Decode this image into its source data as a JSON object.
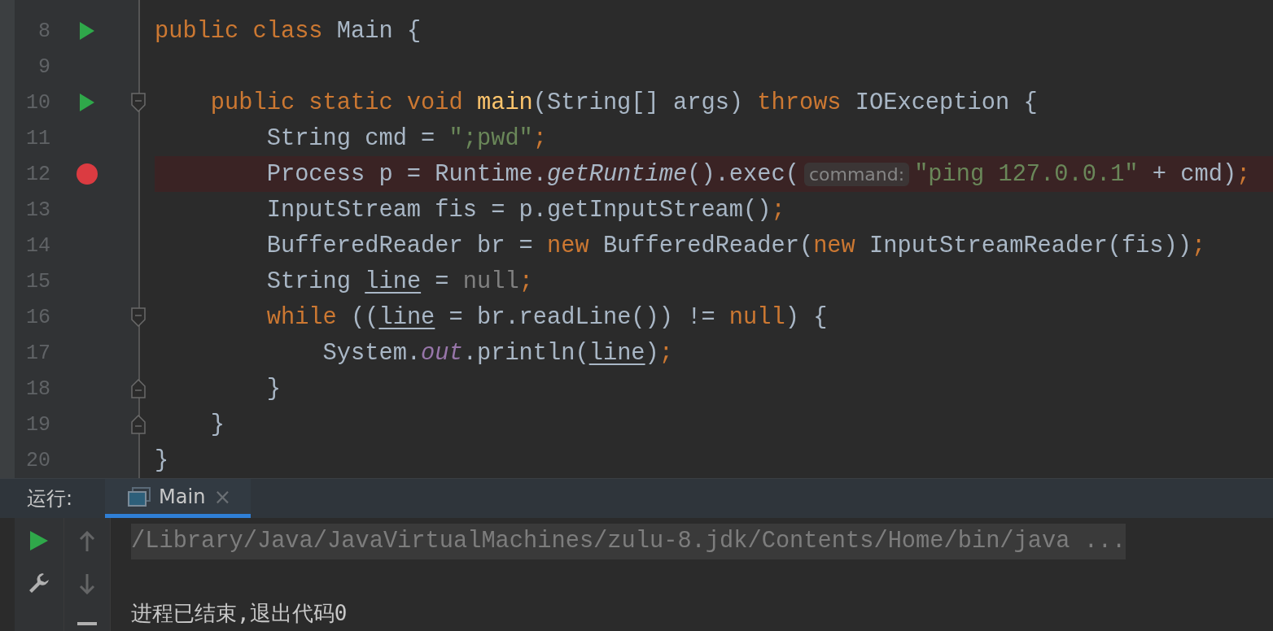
{
  "editor": {
    "lines": [
      {
        "number": "8",
        "runnable": true,
        "breakpoint": false,
        "fold_start": false,
        "fold_end": false,
        "highlighted": false,
        "tokens": [
          {
            "kind": "keyword",
            "text": "public class"
          },
          {
            "kind": "plain",
            "text": " Main {"
          }
        ],
        "children": [
          {
            "number": "9",
            "runnable": false,
            "breakpoint": false,
            "fold_start": false,
            "fold_end": false,
            "highlighted": false
          },
          {
            "number": "10",
            "runnable": true,
            "breakpoint": false,
            "fold_start": true,
            "fold_end": false,
            "highlighted": false,
            "tokens": [
              {
                "kind": "keyword",
                "text": "public static void "
              },
              {
                "kind": "method",
                "text": "main"
              },
              {
                "kind": "plain",
                "text": "(String[] args) "
              },
              {
                "kind": "keyword",
                "text": "throws"
              },
              {
                "kind": "plain",
                "text": " IOException {"
              }
            ],
            "children": [
              {
                "number": "11",
                "runnable": false,
                "breakpoint": false,
                "fold_start": false,
                "fold_end": false,
                "highlighted": false,
                "tokens": [
                  {
                    "kind": "plain",
                    "text": "String cmd = "
                  },
                  {
                    "kind": "string",
                    "text": "\";pwd\""
                  },
                  {
                    "kind": "punct",
                    "text": ";"
                  }
                ]
              },
              {
                "number": "12",
                "runnable": false,
                "breakpoint": true,
                "fold_start": false,
                "fold_end": false,
                "highlighted": true,
                "tokens": [
                  {
                    "kind": "plain",
                    "text": "Process p = Runtime."
                  },
                  {
                    "kind": "static",
                    "text": "getRuntime"
                  },
                  {
                    "kind": "plain",
                    "text": "().exec("
                  },
                  {
                    "kind": "hint",
                    "text": "command:"
                  },
                  {
                    "kind": "string",
                    "text": "\"ping 127.0.0.1\""
                  },
                  {
                    "kind": "plain",
                    "text": " + cmd)"
                  },
                  {
                    "kind": "punct",
                    "text": ";"
                  }
                ]
              },
              {
                "number": "13",
                "runnable": false,
                "breakpoint": false,
                "fold_start": false,
                "fold_end": false,
                "highlighted": false,
                "tokens": [
                  {
                    "kind": "plain",
                    "text": "InputStream fis = p.getInputStream()"
                  },
                  {
                    "kind": "punct",
                    "text": ";"
                  }
                ]
              },
              {
                "number": "14",
                "runnable": false,
                "breakpoint": false,
                "fold_start": false,
                "fold_end": false,
                "highlighted": false,
                "tokens": [
                  {
                    "kind": "plain",
                    "text": "BufferedReader br = "
                  },
                  {
                    "kind": "keyword",
                    "text": "new"
                  },
                  {
                    "kind": "plain",
                    "text": " BufferedReader("
                  },
                  {
                    "kind": "keyword",
                    "text": "new"
                  },
                  {
                    "kind": "plain",
                    "text": " InputStreamReader(fis))"
                  },
                  {
                    "kind": "punct",
                    "text": ";"
                  }
                ]
              },
              {
                "number": "15",
                "runnable": false,
                "breakpoint": false,
                "fold_start": false,
                "fold_end": false,
                "highlighted": false,
                "tokens": [
                  {
                    "kind": "plain",
                    "text": "String "
                  },
                  {
                    "kind": "var",
                    "text": "line"
                  },
                  {
                    "kind": "plain",
                    "text": " = "
                  },
                  {
                    "kind": "unused",
                    "text": "null"
                  },
                  {
                    "kind": "punct",
                    "text": ";"
                  }
                ]
              },
              {
                "number": "16",
                "runnable": false,
                "breakpoint": false,
                "fold_start": true,
                "fold_end": false,
                "highlighted": false,
                "tokens": [
                  {
                    "kind": "keyword",
                    "text": "while"
                  },
                  {
                    "kind": "plain",
                    "text": " (("
                  },
                  {
                    "kind": "var",
                    "text": "line"
                  },
                  {
                    "kind": "plain",
                    "text": " = br.readLine()) != "
                  },
                  {
                    "kind": "keyword",
                    "text": "null"
                  },
                  {
                    "kind": "plain",
                    "text": ") {"
                  }
                ],
                "children": [
                  {
                    "number": "17",
                    "runnable": false,
                    "breakpoint": false,
                    "fold_start": false,
                    "fold_end": false,
                    "highlighted": false,
                    "tokens": [
                      {
                        "kind": "plain",
                        "text": "System."
                      },
                      {
                        "kind": "field",
                        "text": "out"
                      },
                      {
                        "kind": "plain",
                        "text": ".println("
                      },
                      {
                        "kind": "var",
                        "text": "line"
                      },
                      {
                        "kind": "plain",
                        "text": ")"
                      },
                      {
                        "kind": "punct",
                        "text": ";"
                      }
                    ]
                  }
                ]
              },
              {
                "number": "18",
                "runnable": false,
                "breakpoint": false,
                "fold_start": false,
                "fold_end": true,
                "highlighted": false,
                "tokens": [
                  {
                    "kind": "plain",
                    "text": "}"
                  }
                ]
              }
            ]
          },
          {
            "number": "19",
            "runnable": false,
            "breakpoint": false,
            "fold_start": false,
            "fold_end": true,
            "highlighted": false,
            "tokens": [
              {
                "kind": "plain",
                "text": "}"
              }
            ]
          }
        ]
      },
      {
        "number": "20",
        "runnable": false,
        "breakpoint": false,
        "fold_start": false,
        "fold_end": false,
        "highlighted": false,
        "tokens": [
          {
            "kind": "plain",
            "text": "}"
          }
        ]
      }
    ]
  },
  "run_panel": {
    "label": "运行:",
    "tabs": [
      {
        "label": "Main",
        "selected": true,
        "close": "×"
      }
    ],
    "left_tools": [
      {
        "kind": "run",
        "disabled": false
      },
      {
        "kind": "wrench",
        "disabled": false
      }
    ],
    "right_tools": [
      {
        "kind": "up",
        "disabled": true
      },
      {
        "kind": "down",
        "disabled": true
      },
      {
        "kind": "minus",
        "disabled": false
      }
    ],
    "console": [
      {
        "kind": "command",
        "text": "/Library/Java/JavaVirtualMachines/zulu-8.jdk/Contents/Home/bin/java ..."
      },
      {
        "kind": "exit",
        "text": "进程已结束,退出代码0"
      }
    ]
  }
}
